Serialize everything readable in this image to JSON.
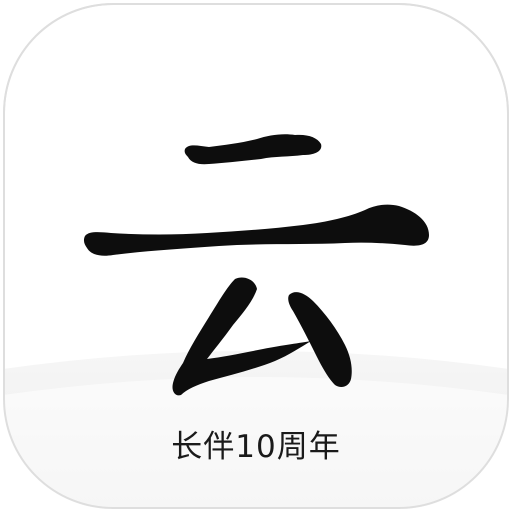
{
  "app_icon": {
    "glyph_icon": "yun-calligraphy-icon",
    "caption": "长伴10周年",
    "colors": {
      "background": "#ffffff",
      "wave_shading": "#f0f0f0",
      "ink": "#0d0d0d",
      "caption": "#1a1a1a",
      "border": "#dedede"
    }
  }
}
